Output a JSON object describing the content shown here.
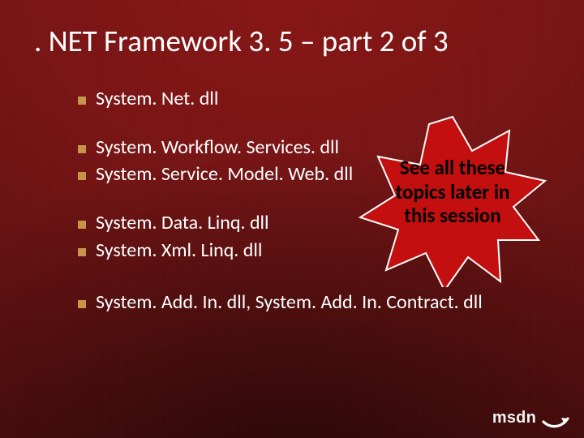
{
  "title": ". NET Framework 3. 5 – part 2 of 3",
  "bullets": {
    "group1": [
      "System. Net. dll"
    ],
    "group2": [
      "System. Workflow. Services. dll",
      "System. Service. Model. Web. dll"
    ],
    "group3": [
      "System. Data. Linq. dll",
      "System. Xml. Linq. dll"
    ],
    "group4": [
      "System. Add. In. dll, System. Add. In. Contract. dll"
    ]
  },
  "callout": "See all these topics later in this session",
  "brand": "msdn"
}
